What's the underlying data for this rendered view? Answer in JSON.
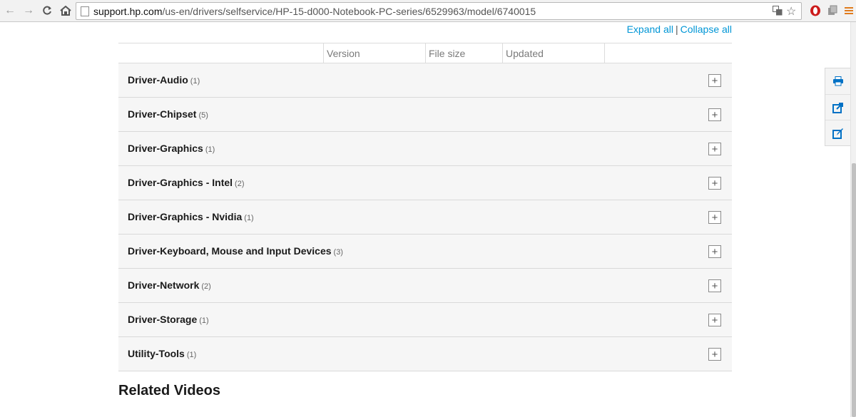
{
  "browser": {
    "url_host": "support.hp.com",
    "url_path": "/us-en/drivers/selfservice/HP-15-d000-Notebook-PC-series/6529963/model/6740015"
  },
  "actions": {
    "expand_all": "Expand all",
    "separator": "|",
    "collapse_all": "Collapse all"
  },
  "table_header": {
    "columns": [
      "Version",
      "File size",
      "Updated"
    ]
  },
  "categories": [
    {
      "name": "Driver-Audio",
      "count": "(1)"
    },
    {
      "name": "Driver-Chipset",
      "count": "(5)"
    },
    {
      "name": "Driver-Graphics",
      "count": "(1)"
    },
    {
      "name": "Driver-Graphics - Intel",
      "count": "(2)"
    },
    {
      "name": "Driver-Graphics - Nvidia",
      "count": "(1)"
    },
    {
      "name": "Driver-Keyboard, Mouse and Input Devices",
      "count": "(3)"
    },
    {
      "name": "Driver-Network",
      "count": "(2)"
    },
    {
      "name": "Driver-Storage",
      "count": "(1)"
    },
    {
      "name": "Utility-Tools",
      "count": "(1)"
    }
  ],
  "section_title": "Related Videos",
  "colors": {
    "link": "#0096d6",
    "tool_icon": "#0071c5",
    "opera_red": "#cc1b1b",
    "menu_orange": "#e07b1c"
  }
}
